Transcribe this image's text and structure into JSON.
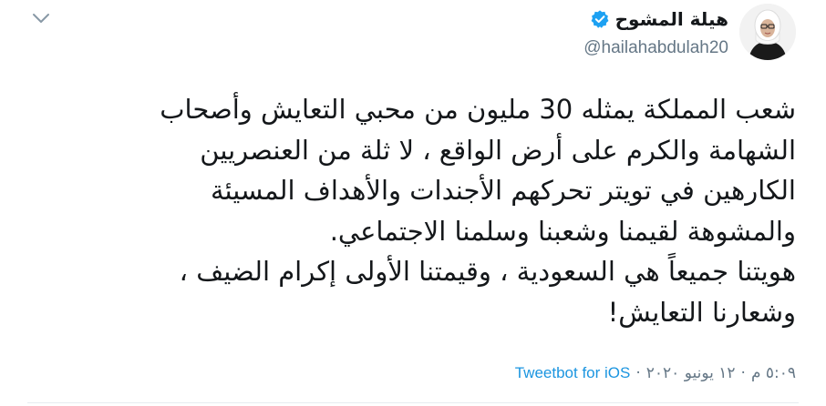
{
  "user": {
    "display_name": "هيلة المشوح",
    "handle": "@hailahabdulah20",
    "verified": true
  },
  "tweet": {
    "lines": [
      "شعب المملكة يمثله 30 مليون من محبي التعايش وأصحاب",
      "الشهامة والكرم على أرض الواقع ، لا ثلة من العنصريين",
      "الكارهين في تويتر تحركهم الأجندات والأهداف المسيئة",
      "والمشوهة لقيمنا وشعبنا وسلمنا الاجتماعي.",
      "هويتنا جميعاً هي السعودية ، وقيمتنا الأولى إكرام الضيف ،",
      "وشعارنا التعايش!"
    ]
  },
  "meta": {
    "time": "٥:٠٩ م",
    "separator": "·",
    "date": "١٢ يونيو ٢٠٢٠",
    "separator2": "·",
    "source": "Tweetbot for iOS"
  },
  "icons": {
    "verified": "verified-badge-icon",
    "menu": "chevron-down-icon",
    "avatar": "avatar-photo"
  },
  "colors": {
    "text": "#14171a",
    "secondary": "#657786",
    "link": "#1b95e0",
    "verified": "#1da1f2"
  }
}
